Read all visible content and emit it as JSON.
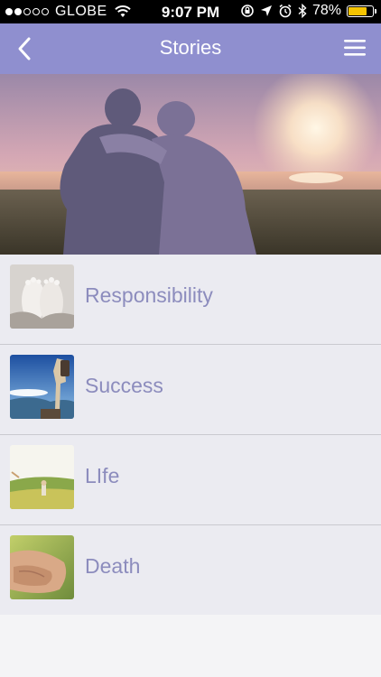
{
  "status_bar": {
    "carrier": "GLOBE",
    "time": "9:07 PM",
    "battery_percent": "78%",
    "battery_level": 0.78,
    "signal_bars_filled": 2,
    "signal_bars_total": 5,
    "icons": [
      "wifi-icon",
      "rotation-lock-icon",
      "location-icon",
      "alarm-icon",
      "bluetooth-icon",
      "battery-icon"
    ]
  },
  "nav": {
    "title": "Stories",
    "back_icon": "chevron-left-icon",
    "menu_icon": "hamburger-menu-icon"
  },
  "hero": {
    "image": "elderly-couple-sunset-photo"
  },
  "stories": [
    {
      "label": "Responsibility",
      "thumbnail": "baby-feet-photo"
    },
    {
      "label": "Success",
      "thumbnail": "hiker-mountain-photo"
    },
    {
      "label": "LIfe",
      "thumbnail": "child-meadow-photo"
    },
    {
      "label": "Death",
      "thumbnail": "holding-hands-photo"
    }
  ],
  "colors": {
    "nav_bar": "#8f8fcf",
    "list_text": "#8c8cbd",
    "list_bg": "#ebebf1",
    "battery": "#f5c400"
  }
}
